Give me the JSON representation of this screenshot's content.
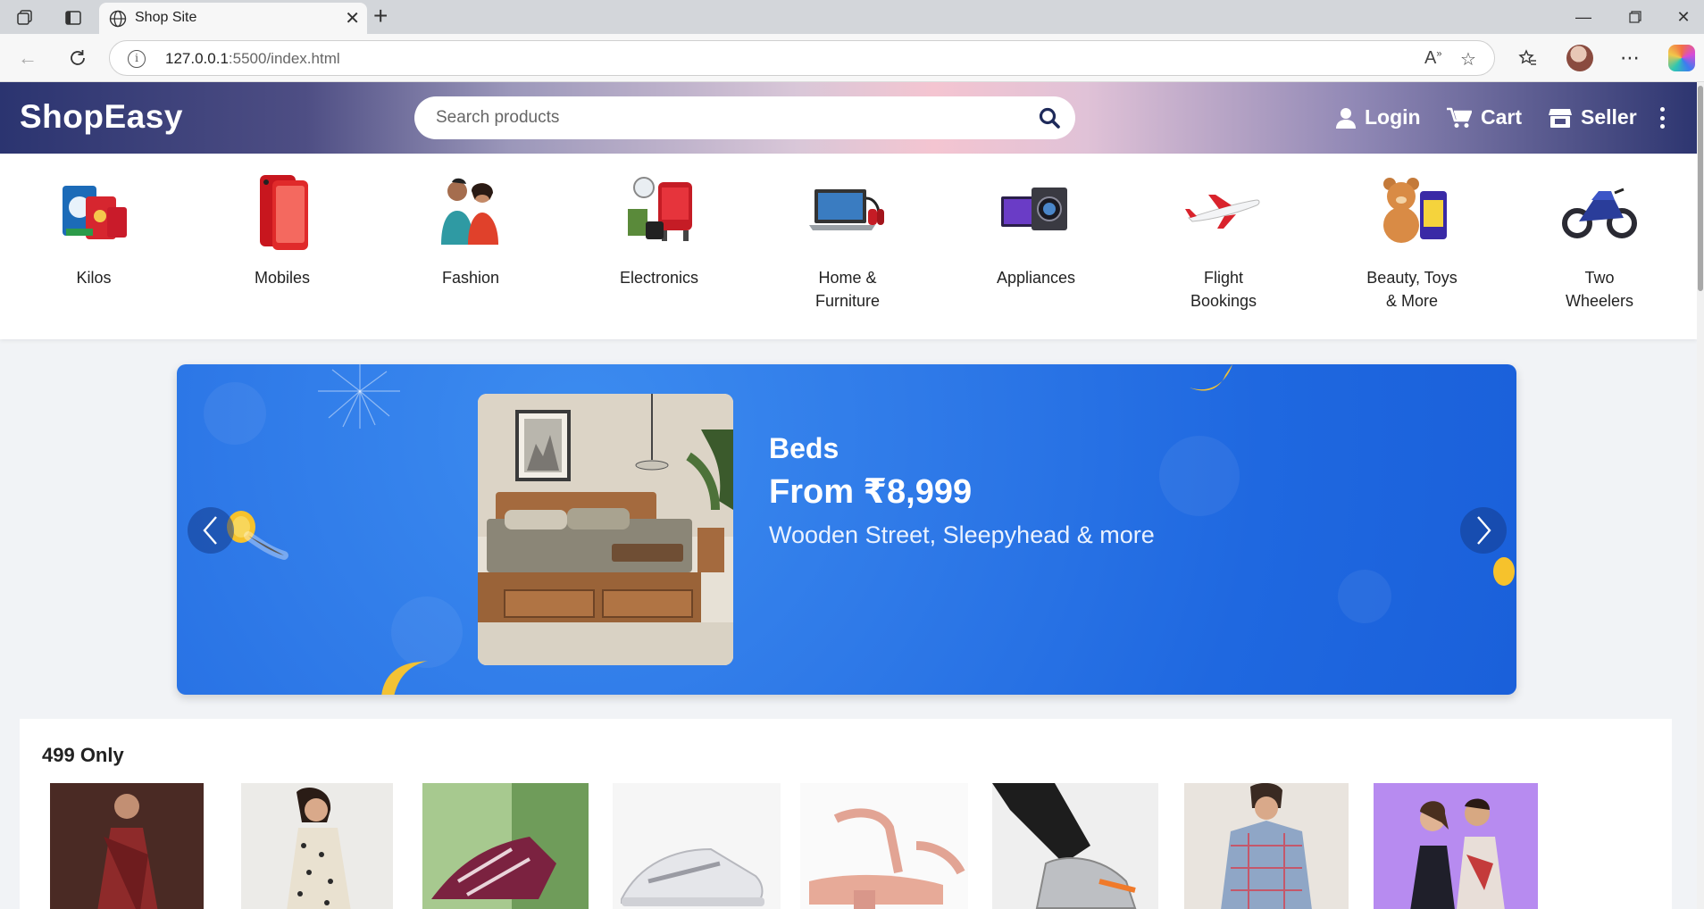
{
  "browser": {
    "tab_title": "Shop Site",
    "url_host": "127.0.0.1",
    "url_path": ":5500/index.html"
  },
  "header": {
    "logo": "ShopEasy",
    "search_placeholder": "Search products",
    "login": "Login",
    "cart": "Cart",
    "seller": "Seller"
  },
  "categories": [
    {
      "label": "Kilos"
    },
    {
      "label": "Mobiles"
    },
    {
      "label": "Fashion"
    },
    {
      "label": "Electronics"
    },
    {
      "label": "Home &\nFurniture"
    },
    {
      "label": "Appliances"
    },
    {
      "label": "Flight\nBookings"
    },
    {
      "label": "Beauty, Toys\n& More"
    },
    {
      "label": "Two\nWheelers"
    }
  ],
  "banner": {
    "title": "Beds",
    "price": "From ₹8,999",
    "subtitle": "Wooden Street, Sleepyhead & more"
  },
  "deals": {
    "title": "499 Only"
  },
  "colors": {
    "header_dark": "#2b3470",
    "header_pink": "#f4c5d1",
    "banner_blue": "#1f68e0"
  }
}
